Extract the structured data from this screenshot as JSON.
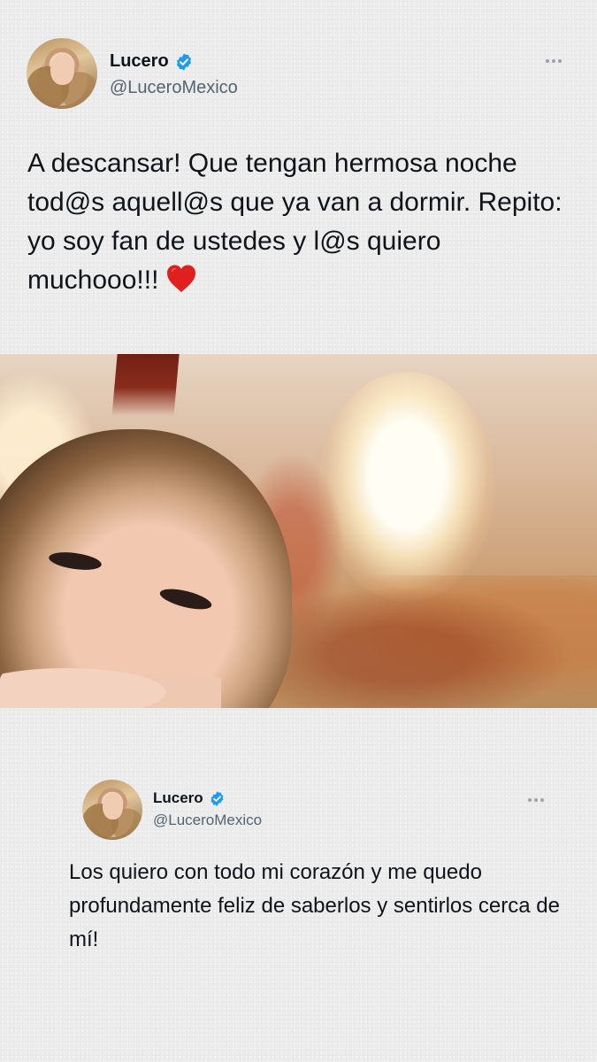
{
  "tweet1": {
    "display_name": "Lucero",
    "handle": "@LuceroMexico",
    "text": "A descansar! Que tengan hermosa noche tod@s aquell@s que ya van a dormir. Repito: yo soy fan de ustedes y l@s quiero muchooo!!!",
    "emoji_icon": "red-heart-icon",
    "verified_icon": "verified-badge-icon",
    "more_icon": "more-options-icon"
  },
  "photo": {
    "icon": "tweet-photo"
  },
  "tweet2": {
    "display_name": "Lucero",
    "handle": "@LuceroMexico",
    "text": "Los quiero con todo mi corazón y me quedo profundamente feliz de saberlos y sentirlos cerca de mí!",
    "verified_icon": "verified-badge-icon",
    "more_icon": "more-options-icon"
  },
  "colors": {
    "verified": "#1d9bf0",
    "text": "#0f1419",
    "secondary": "#536471",
    "heart": "#e0201e"
  }
}
